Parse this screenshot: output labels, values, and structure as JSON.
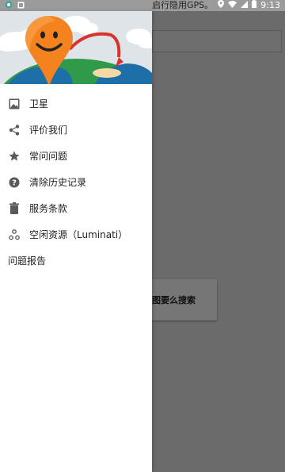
{
  "status_bar": {
    "time": "9:13",
    "notification_text": "启行隐用GPS。",
    "icons": [
      "app-icon",
      "notification-icon",
      "location-icon",
      "wifi-icon",
      "signal-icon",
      "battery-icon"
    ]
  },
  "background": {
    "card_text": "图要么搜索"
  },
  "drawer": {
    "items": [
      {
        "icon": "image-icon",
        "label": "卫星"
      },
      {
        "icon": "share-icon",
        "label": "评价我们"
      },
      {
        "icon": "star-icon",
        "label": "常问问题"
      },
      {
        "icon": "help-icon",
        "label": "清除历史记录"
      },
      {
        "icon": "trash-icon",
        "label": "服务条款"
      },
      {
        "icon": "network-icon",
        "label": "空闲资源（Luminati）"
      },
      {
        "icon": "",
        "label": "问题报告"
      }
    ]
  },
  "colors": {
    "drawer_bg": "#ffffff",
    "overlay": "#6b6b6b",
    "pin_orange": "#f4831f",
    "globe_green": "#2f9a4a",
    "sky": "#d6dde3"
  }
}
